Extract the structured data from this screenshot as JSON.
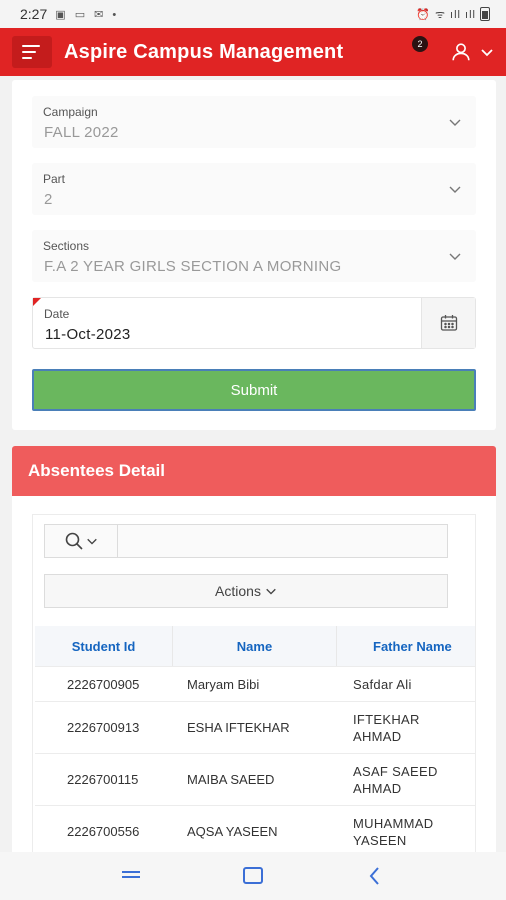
{
  "status_bar": {
    "time": "2:27",
    "notification_glyphs": "▣ ▭ ✉ •",
    "system_glyphs": "⏰ ᯤ ıll ıll"
  },
  "header": {
    "title": "Aspire Campus Management",
    "notification_count": "2"
  },
  "form": {
    "campaign": {
      "label": "Campaign",
      "value": "FALL 2022"
    },
    "part": {
      "label": "Part",
      "value": "2"
    },
    "sections": {
      "label": "Sections",
      "value": "F.A 2 YEAR GIRLS SECTION A MORNING"
    },
    "date": {
      "label": "Date",
      "value": "11-Oct-2023"
    },
    "submit_label": "Submit"
  },
  "absentees": {
    "title": "Absentees Detail",
    "search_placeholder": "",
    "actions_label": "Actions",
    "columns": [
      "Student Id",
      "Name",
      "Father Name"
    ],
    "rows": [
      {
        "student_id": "2226700905",
        "name": "Maryam Bibi",
        "father_name": "Safdar Ali"
      },
      {
        "student_id": "2226700913",
        "name": "ESHA IFTEKHAR",
        "father_name": "IFTEKHAR AHMAD"
      },
      {
        "student_id": "2226700115",
        "name": "MAIBA SAEED",
        "father_name": "ASAF SAEED AHMAD"
      },
      {
        "student_id": "2226700556",
        "name": "AQSA YASEEN",
        "father_name": "MUHAMMAD YASEEN"
      }
    ]
  },
  "colors": {
    "brand_red": "#e02424",
    "section_header": "#ef5c5c",
    "submit_green": "#6ab75e",
    "link_blue": "#1565c0"
  }
}
